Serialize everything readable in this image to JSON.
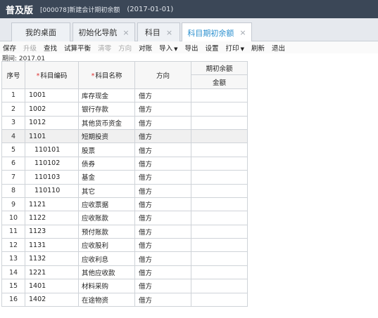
{
  "title_bar": {
    "app_name": "普及版",
    "account": "[000078]新建会计期初余额",
    "date": "(2017-01-01)"
  },
  "tabs": [
    {
      "label": "我的桌面",
      "closable": false,
      "active": false
    },
    {
      "label": "初始化导航",
      "closable": true,
      "active": false
    },
    {
      "label": "科目",
      "closable": true,
      "active": false
    },
    {
      "label": "科目期初余额",
      "closable": true,
      "active": true
    }
  ],
  "tab_close_glyph": "×",
  "toolbar": [
    {
      "label": "保存",
      "dim": false,
      "dropdown": false
    },
    {
      "label": "升级",
      "dim": true,
      "dropdown": false
    },
    {
      "label": "查找",
      "dim": false,
      "dropdown": false
    },
    {
      "label": "试算平衡",
      "dim": false,
      "dropdown": false
    },
    {
      "label": "清零",
      "dim": true,
      "dropdown": false
    },
    {
      "label": "方向",
      "dim": true,
      "dropdown": false
    },
    {
      "label": "对账",
      "dim": false,
      "dropdown": false
    },
    {
      "label": "导入",
      "dim": false,
      "dropdown": true
    },
    {
      "label": "导出",
      "dim": false,
      "dropdown": false
    },
    {
      "label": "设置",
      "dim": false,
      "dropdown": false
    },
    {
      "label": "打印",
      "dim": false,
      "dropdown": true
    },
    {
      "label": "刷新",
      "dim": false,
      "dropdown": false
    },
    {
      "label": "退出",
      "dim": false,
      "dropdown": false
    }
  ],
  "period": "期间: 2017.01",
  "table": {
    "headers": {
      "index": "序号",
      "code": "科目编码",
      "name": "科目名称",
      "direction": "方向",
      "opening_group": "期初余额",
      "amount": "金额"
    },
    "required_mark": "*",
    "rows": [
      {
        "index": "1",
        "code": "1001",
        "name": "库存现金",
        "direction": "借方",
        "amount": "",
        "child": false
      },
      {
        "index": "2",
        "code": "1002",
        "name": "银行存款",
        "direction": "借方",
        "amount": "",
        "child": false
      },
      {
        "index": "3",
        "code": "1012",
        "name": "其他货币资金",
        "direction": "借方",
        "amount": "",
        "child": false
      },
      {
        "index": "4",
        "code": "1101",
        "name": "短期投资",
        "direction": "借方",
        "amount": "",
        "child": false
      },
      {
        "index": "5",
        "code": "110101",
        "name": "股票",
        "direction": "借方",
        "amount": "",
        "child": true
      },
      {
        "index": "6",
        "code": "110102",
        "name": "债券",
        "direction": "借方",
        "amount": "",
        "child": true
      },
      {
        "index": "7",
        "code": "110103",
        "name": "基金",
        "direction": "借方",
        "amount": "",
        "child": true
      },
      {
        "index": "8",
        "code": "110110",
        "name": "其它",
        "direction": "借方",
        "amount": "",
        "child": true
      },
      {
        "index": "9",
        "code": "1121",
        "name": "应收票据",
        "direction": "借方",
        "amount": "",
        "child": false
      },
      {
        "index": "10",
        "code": "1122",
        "name": "应收账款",
        "direction": "借方",
        "amount": "",
        "child": false
      },
      {
        "index": "11",
        "code": "1123",
        "name": "预付账款",
        "direction": "借方",
        "amount": "",
        "child": false
      },
      {
        "index": "12",
        "code": "1131",
        "name": "应收股利",
        "direction": "借方",
        "amount": "",
        "child": false
      },
      {
        "index": "13",
        "code": "1132",
        "name": "应收利息",
        "direction": "借方",
        "amount": "",
        "child": false
      },
      {
        "index": "14",
        "code": "1221",
        "name": "其他应收款",
        "direction": "借方",
        "amount": "",
        "child": false
      },
      {
        "index": "15",
        "code": "1401",
        "name": "材料采购",
        "direction": "借方",
        "amount": "",
        "child": false
      },
      {
        "index": "16",
        "code": "1402",
        "name": "在途物资",
        "direction": "借方",
        "amount": "",
        "child": false
      }
    ],
    "selected_row": "4"
  }
}
